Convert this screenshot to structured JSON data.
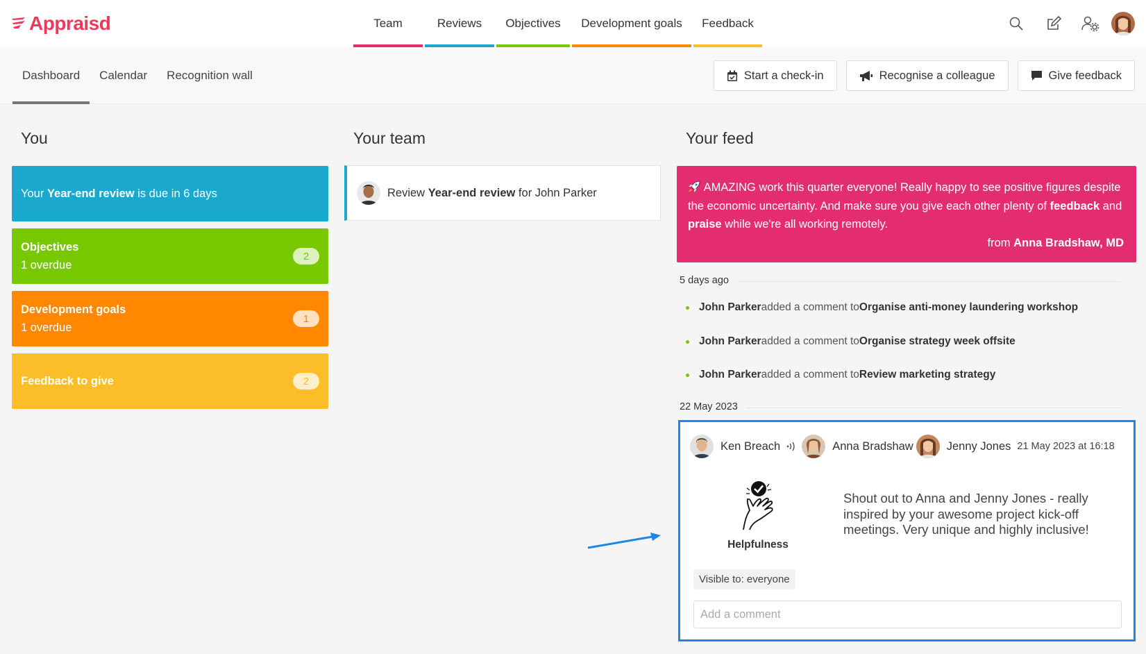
{
  "app": {
    "name": "Appraisd",
    "brand_color": "#ec3a5c"
  },
  "nav": {
    "items": [
      {
        "label": "Team",
        "color": "#e42d71"
      },
      {
        "label": "Reviews",
        "color": "#1ba8cf"
      },
      {
        "label": "Objectives",
        "color": "#78c800"
      },
      {
        "label": "Development goals",
        "color": "#ff8800"
      },
      {
        "label": "Feedback",
        "color": "#fbbd28"
      }
    ]
  },
  "header_icons": [
    "search-icon",
    "edit-icon",
    "user-settings-icon",
    "user-avatar"
  ],
  "subnav": {
    "tabs": [
      {
        "label": "Dashboard",
        "active": true
      },
      {
        "label": "Calendar",
        "active": false
      },
      {
        "label": "Recognition wall",
        "active": false
      }
    ]
  },
  "actions": {
    "checkin": "Start a check-in",
    "recognise": "Recognise a colleague",
    "feedback": "Give feedback"
  },
  "you": {
    "title": "You",
    "review": {
      "pre": "Your ",
      "bold": "Year-end review",
      "post": " is due in 6 days",
      "color": "#1ba8cf"
    },
    "objectives": {
      "label": "Objectives",
      "sub": "1 overdue",
      "count": "2",
      "color": "#78c800"
    },
    "devgoals": {
      "label": "Development goals",
      "sub": "1 overdue",
      "count": "1",
      "color": "#ff8800"
    },
    "feedback": {
      "label": "Feedback to give",
      "count": "2",
      "color": "#fbbd28"
    }
  },
  "team": {
    "title": "Your team",
    "card": {
      "pre": "Review ",
      "bold": "Year-end review",
      "mid": " for ",
      "person": "John Parker"
    }
  },
  "feed": {
    "title": "Your feed",
    "announcement": {
      "text1": " AMAZING work this quarter everyone! Really happy to see positive figures despite the economic uncertainty. And make sure you give each other plenty of ",
      "b1": "feedback",
      "text2": " and ",
      "b2": "praise",
      "text3": " while we're all working remotely.",
      "from_pre": "from ",
      "from_name": "Anna Bradshaw, MD",
      "color": "#e42d71"
    },
    "group1": {
      "date": "5 days ago",
      "items": [
        {
          "who": "John Parker",
          "action": " added a comment to ",
          "target": "Organise anti-money laundering workshop"
        },
        {
          "who": "John Parker",
          "action": " added a comment to ",
          "target": "Organise strategy week offsite"
        },
        {
          "who": "John Parker",
          "action": " added a comment to ",
          "target": "Review marketing strategy"
        }
      ]
    },
    "group2": {
      "date": "22 May 2023"
    },
    "recognition": {
      "from": "Ken Breach",
      "to1": "Anna Bradshaw",
      "to2": "Jenny Jones",
      "time": "21 May 2023 at 16:18",
      "message": "Shout out to Anna and Jenny Jones - really inspired by your awesome project kick-off meetings. Very unique and highly inclusive!",
      "value": "Helpfulness",
      "visibility": "Visible to: everyone",
      "comment_placeholder": "Add a comment",
      "highlight_color": "#1d87e8"
    }
  }
}
